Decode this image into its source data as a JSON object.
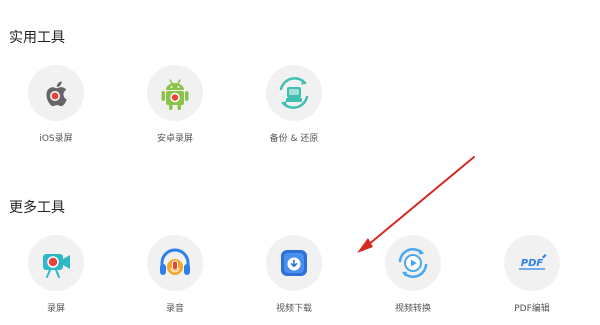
{
  "sections": [
    {
      "title": "实用工具",
      "tools": [
        {
          "label": "iOS录屏",
          "icon": "apple-record-icon"
        },
        {
          "label": "安卓录屏",
          "icon": "android-record-icon"
        },
        {
          "label": "备份 & 还原",
          "icon": "backup-restore-icon"
        }
      ]
    },
    {
      "title": "更多工具",
      "tools": [
        {
          "label": "录屏",
          "icon": "video-camera-record-icon"
        },
        {
          "label": "录音",
          "icon": "headphones-mic-icon"
        },
        {
          "label": "视频下载",
          "icon": "video-download-icon"
        },
        {
          "label": "视频转换",
          "icon": "video-convert-icon"
        },
        {
          "label": "PDF编辑",
          "icon": "pdf-edit-icon"
        }
      ]
    }
  ],
  "colors": {
    "record_red": "#e8443a",
    "android_green": "#8bc34a",
    "teal": "#3fbfb0",
    "blue": "#2f7fe8",
    "light_blue": "#4aa8f0",
    "orange": "#f5a623",
    "arrow_red": "#d42a22"
  }
}
